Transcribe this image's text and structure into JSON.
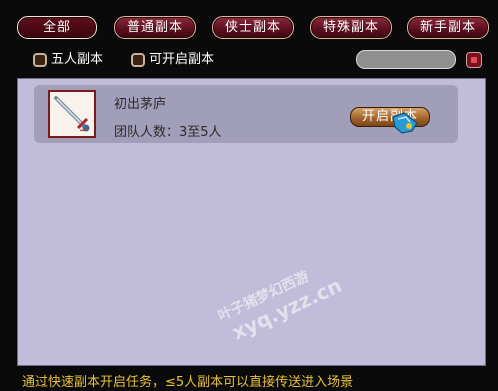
{
  "tabs": [
    {
      "label": "全部",
      "active": true
    },
    {
      "label": "普通副本",
      "active": false
    },
    {
      "label": "侠士副本",
      "active": false
    },
    {
      "label": "特殊副本",
      "active": false
    },
    {
      "label": "新手副本",
      "active": false
    }
  ],
  "filters": {
    "five_person": "五人副本",
    "openable": "可开启副本"
  },
  "search": {
    "value": "",
    "button_icon": "search-button-icon"
  },
  "items": [
    {
      "name": "初出茅庐",
      "team_info": "团队人数：3至5人",
      "button_label": "开启副本",
      "icon": "sword-icon"
    }
  ],
  "watermark": {
    "line1": "叶子猪梦幻西游",
    "line2": "xyq.yzz.cn"
  },
  "footer": {
    "text": "通过快速副本开启任务，≤5人副本可以直接传送进入场景"
  },
  "colors": {
    "tab_bg": "#5a0f1e",
    "panel_bg": "#c0bcd9",
    "item_bg": "#a09eb8",
    "footer_text": "#e8c23a",
    "open_button": "#a3662e"
  }
}
